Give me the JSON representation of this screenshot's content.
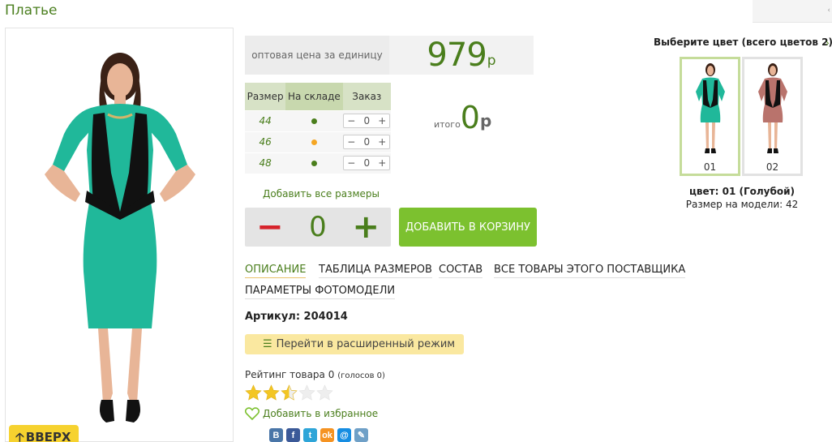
{
  "product": {
    "title": "Платье",
    "price_label": "оптовая цена за единицу",
    "price_value": "979",
    "price_currency": "р",
    "total_word": "итого",
    "total_value": "0",
    "total_currency": "р",
    "article": "Артикул: 204014"
  },
  "sizes_table": {
    "headers": {
      "size": "Размер",
      "stock": "На складе",
      "order": "Заказ"
    },
    "rows": [
      {
        "size": "44",
        "stock_color": "#4a7e1c",
        "qty": "0"
      },
      {
        "size": "46",
        "stock_color": "#f5a623",
        "qty": "0"
      },
      {
        "size": "48",
        "stock_color": "#4a7e1c",
        "qty": "0"
      }
    ],
    "stepper_minus": "−",
    "stepper_plus": "+"
  },
  "actions": {
    "add_all_sizes": "Добавить все размеры",
    "qty_minus": "−",
    "qty_value": "0",
    "qty_plus": "+",
    "add_to_cart": "ДОБАВИТЬ В КОРЗИНУ",
    "advanced_mode": "Перейти в расширенный режим",
    "add_favorite": "Добавить в избранное",
    "scroll_up": "ВВЕРХ"
  },
  "tabs": [
    {
      "label": "ОПИСАНИЕ",
      "active": true
    },
    {
      "label": "ТАБЛИЦА РАЗМЕРОВ",
      "active": false
    },
    {
      "label": "СОСТАВ",
      "active": false
    },
    {
      "label": "ВСЕ ТОВАРЫ ЭТОГО ПОСТАВЩИКА",
      "active": false
    },
    {
      "label": "ПАРАМЕТРЫ ФОТОМОДЕЛИ",
      "active": false
    }
  ],
  "rating": {
    "label": "Рейтинг товара 0",
    "votes": "(голосов 0)",
    "stars_filled": 2.5,
    "stars_total": 5
  },
  "colors": {
    "title": "Выберите цвет (всего цветов 2)",
    "swatches": [
      {
        "code": "01",
        "color": "#20b89a",
        "selected": true
      },
      {
        "code": "02",
        "color": "#b9736c",
        "selected": false
      }
    ],
    "selected_name": "цвет: 01 (Голубой)",
    "model_size": "Размер на модели: 42"
  },
  "share": [
    {
      "icon": "vk-icon",
      "letter": "B",
      "color": "#4a76a8"
    },
    {
      "icon": "facebook-icon",
      "letter": "f",
      "color": "#3b5998"
    },
    {
      "icon": "twitter-icon",
      "letter": "t",
      "color": "#2ea5d8"
    },
    {
      "icon": "odnoklassniki-icon",
      "letter": "ok",
      "color": "#f59322"
    },
    {
      "icon": "mailru-icon",
      "letter": "@",
      "color": "#168de2"
    },
    {
      "icon": "livejournal-icon",
      "letter": "✎",
      "color": "#6fa0c7"
    }
  ],
  "theme": {
    "accent": "#4a7e1c",
    "button_green": "#7cc12f",
    "dress_teal": "#20b89a",
    "minus_red": "#d6232b"
  }
}
